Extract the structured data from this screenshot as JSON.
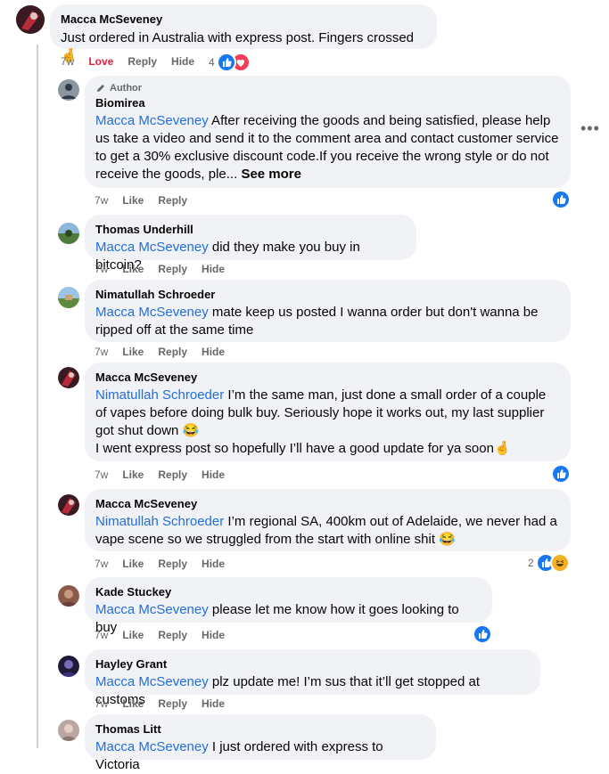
{
  "colors": {
    "like_blue": "#1877f2",
    "love_red": "#f33e58",
    "haha_yellow": "#f7b125",
    "mention": "#216fdb"
  },
  "main": {
    "name": "Macca McSeveney",
    "text": "Just ordered in Australia with express post. Fingers crossed 🤞",
    "time": "7w",
    "love": "Love",
    "reply": "Reply",
    "hide": "Hide",
    "reaction_count": "4"
  },
  "replies": [
    {
      "badge": "Author",
      "name": "Biomirea",
      "mention": "Macca McSeveney",
      "text": " After receiving the goods and being satisfied, please help us take a video and send it to the comment area and contact customer service to get a 30% exclusive discount code.If you receive the wrong style or do not receive the goods, ple...",
      "see_more": "See more",
      "time": "7w",
      "like": "Like",
      "reply": "Reply"
    },
    {
      "name": "Thomas Underhill",
      "mention": "Macca McSeveney",
      "text": " did they make you buy in bitcoin?",
      "time": "7w",
      "like": "Like",
      "reply": "Reply",
      "hide": "Hide"
    },
    {
      "name": "Nimatullah Schroeder",
      "mention": "Macca McSeveney",
      "text": " mate keep us posted I wanna order but don't wanna be ripped off at the same time",
      "time": "7w",
      "like": "Like",
      "reply": "Reply",
      "hide": "Hide"
    },
    {
      "name": "Macca McSeveney",
      "mention": "Nimatullah Schroeder",
      "text": " I’m the same man, just done a small order of a couple of vapes before doing bulk buy. Seriously hope it works out, my last supplier got shut down 😂",
      "text2": "I went express post so hopefully I’ll have a good update for ya soon🤞",
      "time": "7w",
      "like": "Like",
      "reply": "Reply",
      "hide": "Hide"
    },
    {
      "name": "Macca McSeveney",
      "mention": "Nimatullah Schroeder",
      "text": " I’m regional SA, 400km out of Adelaide, we never had a vape scene so we struggled from the start with online shit 😂",
      "time": "7w",
      "like": "Like",
      "reply": "Reply",
      "hide": "Hide",
      "reaction_count": "2"
    },
    {
      "name": "Kade Stuckey",
      "mention": "Macca McSeveney",
      "text": " please let me know how it goes looking to buy",
      "time": "7w",
      "like": "Like",
      "reply": "Reply",
      "hide": "Hide"
    },
    {
      "name": "Hayley Grant",
      "mention": "Macca McSeveney",
      "text": " plz update me! I’m sus that it’ll get stopped at customs",
      "time": "7w",
      "like": "Like",
      "reply": "Reply",
      "hide": "Hide"
    },
    {
      "name": "Thomas Litt",
      "mention": "Macca McSeveney",
      "text": " I just ordered with express to Victoria"
    }
  ],
  "icons": {
    "more": "more-options-icon",
    "like": "like-reaction-icon",
    "love": "love-reaction-icon",
    "haha": "haha-reaction-icon",
    "pencil": "pencil-icon"
  }
}
